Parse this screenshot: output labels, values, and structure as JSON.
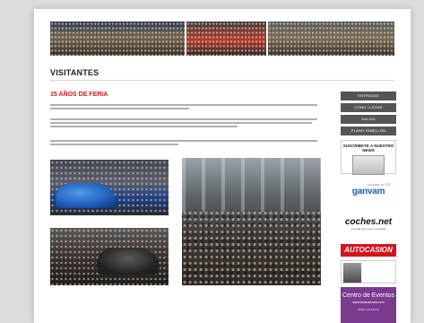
{
  "page": {
    "title": "VISITANTES",
    "section_title": "15 AÑOS DE FERIA"
  },
  "sidebar": {
    "buttons": [
      {
        "label": "ENTRADAS"
      },
      {
        "label": "CÓMO LLEGAR"
      },
      {
        "label": "SALIDA"
      },
      {
        "label": "PLANO PABELLÓN"
      }
    ]
  },
  "promos": {
    "newsletter": {
      "title": "SUSCRÍBETE A NUESTRO NEWS"
    },
    "ganvam": {
      "brand": "ganvam",
      "small": "Asociado al CEF"
    },
    "coches": {
      "brand": "coches.net",
      "small": "el portal del motor en España"
    },
    "autocasion": {
      "brand": "AUTOCASION"
    },
    "events": {
      "brand": "Centro de Eventos",
      "small": "www.feriavalencia.com",
      "small2": "FERIA VALENCIA"
    }
  },
  "colors": {
    "accent_red": "#d4141b",
    "sidebar_button_bg": "#555555",
    "ganvam_blue": "#1b5fb8",
    "events_purple": "#7a3a8e"
  }
}
